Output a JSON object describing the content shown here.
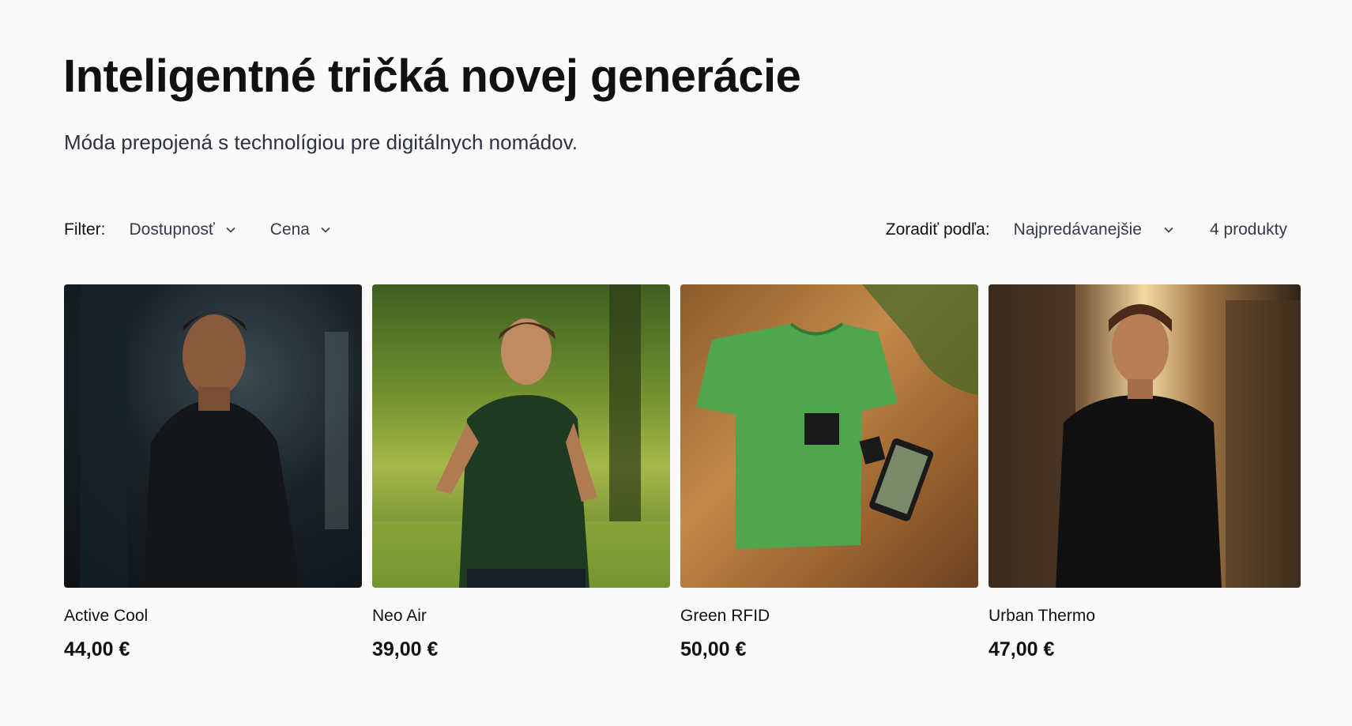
{
  "header": {
    "title": "Inteligentné tričká novej generácie",
    "subtitle": "Móda prepojená s technolígiou pre digitálnych nomádov."
  },
  "toolbar": {
    "filter_label": "Filter:",
    "filters": [
      {
        "label": "Dostupnosť"
      },
      {
        "label": "Cena"
      }
    ],
    "sort_label": "Zoradiť podľa:",
    "sort_value": "Najpredávanejšie",
    "count": "4 produkty"
  },
  "products": [
    {
      "name": "Active Cool",
      "price": "44,00 €",
      "image": "man-black-tshirt-gym"
    },
    {
      "name": "Neo Air",
      "price": "39,00 €",
      "image": "woman-running-park-camo-tshirt"
    },
    {
      "name": "Green RFID",
      "price": "50,00 €",
      "image": "green-tshirt-on-wooden-table-with-phone"
    },
    {
      "name": "Urban Thermo",
      "price": "47,00 €",
      "image": "man-black-tshirt-city-sunset"
    }
  ]
}
